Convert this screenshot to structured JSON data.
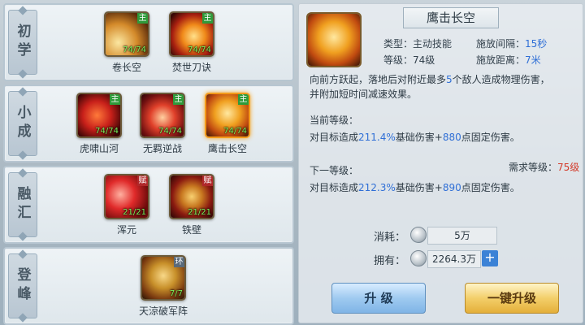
{
  "tiers": [
    {
      "label": "初学",
      "skills": [
        {
          "name": "卷长空",
          "tag": "主",
          "count": "74/74"
        },
        {
          "name": "焚世刀诀",
          "tag": "主",
          "count": "74/74"
        }
      ]
    },
    {
      "label": "小成",
      "skills": [
        {
          "name": "虎啸山河",
          "tag": "主",
          "count": "74/74"
        },
        {
          "name": "无羁逆战",
          "tag": "主",
          "count": "74/74"
        },
        {
          "name": "鹰击长空",
          "tag": "主",
          "count": "74/74"
        }
      ]
    },
    {
      "label": "融汇",
      "skills": [
        {
          "name": "浑元",
          "tag": "赋",
          "count": "21/21"
        },
        {
          "name": "铁壁",
          "tag": "赋",
          "count": "21/21"
        }
      ]
    },
    {
      "label": "登峰",
      "skills": [
        {
          "name": "天涼破军阵",
          "tag": "环",
          "count": "7/7"
        }
      ]
    }
  ],
  "detail": {
    "title": "鹰击长空",
    "type_label": "类型：",
    "type_value": "主动技能",
    "interval_label": "施放间隔：",
    "interval_value": "15秒",
    "level_label": "等级：",
    "level_value": "74级",
    "distance_label": "施放距离：",
    "distance_value": "7米",
    "desc_a": "向前方跃起，落地后对附近最多",
    "desc_num": "5",
    "desc_b": "个敌人造成物理伤害，",
    "desc_line2": "并附加短时间减速效果。",
    "current_label": "当前等级：",
    "current_a": "对目标造成",
    "current_pct": "211.4%",
    "current_b": "基础伤害+",
    "current_fixed": "880",
    "current_c": "点固定伤害。",
    "next_label": "下一等级：",
    "req_label": "需求等级：",
    "req_value": "75级",
    "next_a": "对目标造成",
    "next_pct": "212.3%",
    "next_b": "基础伤害+",
    "next_fixed": "890",
    "next_c": "点固定伤害。"
  },
  "cost": {
    "label": "消耗：",
    "value": "5万"
  },
  "own": {
    "label": "拥有：",
    "value": "2264.3万",
    "plus": "+"
  },
  "buttons": {
    "upgrade": "升  级",
    "one_key": "一键升级"
  }
}
